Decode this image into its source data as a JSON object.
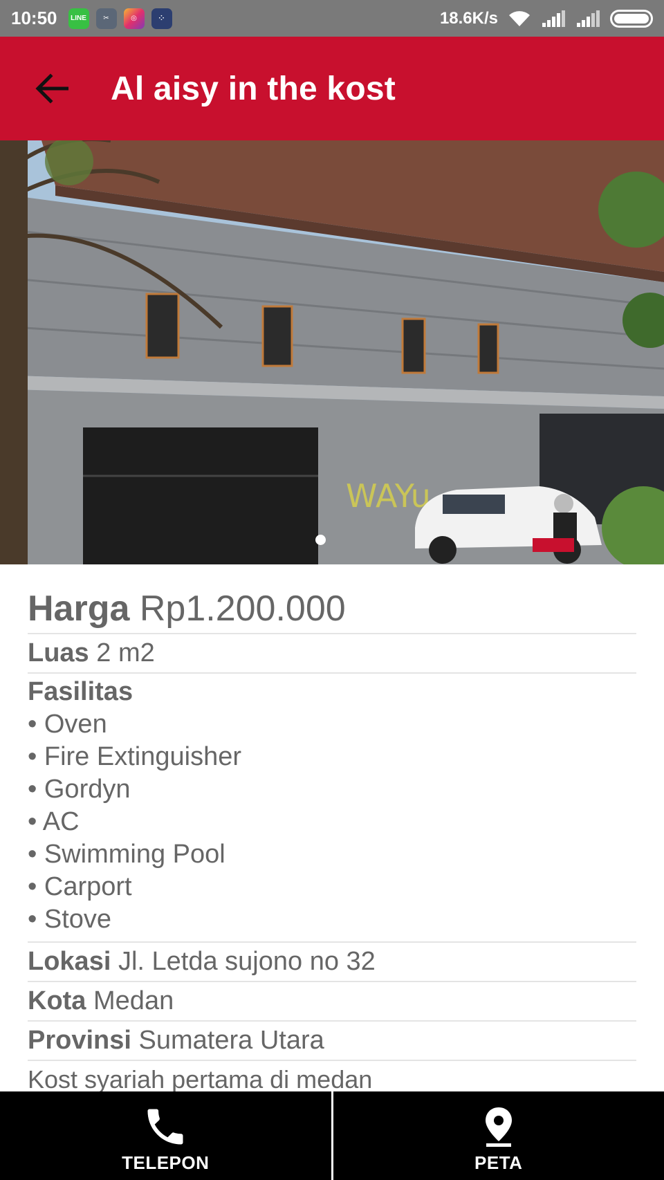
{
  "status_bar": {
    "time": "10:50",
    "net_speed": "18.6K/s",
    "app_icons": [
      "line-icon",
      "cut-icon",
      "instagram-icon",
      "bbm-icon"
    ]
  },
  "app_bar": {
    "title": "Al aisy in the kost",
    "back_icon": "arrow-left-icon",
    "color": "#c8102e"
  },
  "gallery": {
    "current_page": 1
  },
  "details": {
    "harga": {
      "label": "Harga",
      "value": "Rp1.200.000"
    },
    "luas": {
      "label": "Luas",
      "value": "2 m2"
    },
    "fasilitas": {
      "label": "Fasilitas",
      "items": [
        "Oven",
        "Fire Extinguisher",
        "Gordyn",
        "AC",
        "Swimming Pool",
        "Carport",
        "Stove"
      ]
    },
    "lokasi": {
      "label": "Lokasi",
      "value": "Jl. Letda sujono no 32"
    },
    "kota": {
      "label": "Kota",
      "value": "Medan"
    },
    "provinsi": {
      "label": "Provinsi",
      "value": "Sumatera Utara"
    },
    "description": "Kost syariah pertama di medan"
  },
  "bottom_nav": {
    "telepon": {
      "label": "TELEPON",
      "icon": "phone-icon"
    },
    "peta": {
      "label": "PETA",
      "icon": "map-pin-icon"
    }
  }
}
